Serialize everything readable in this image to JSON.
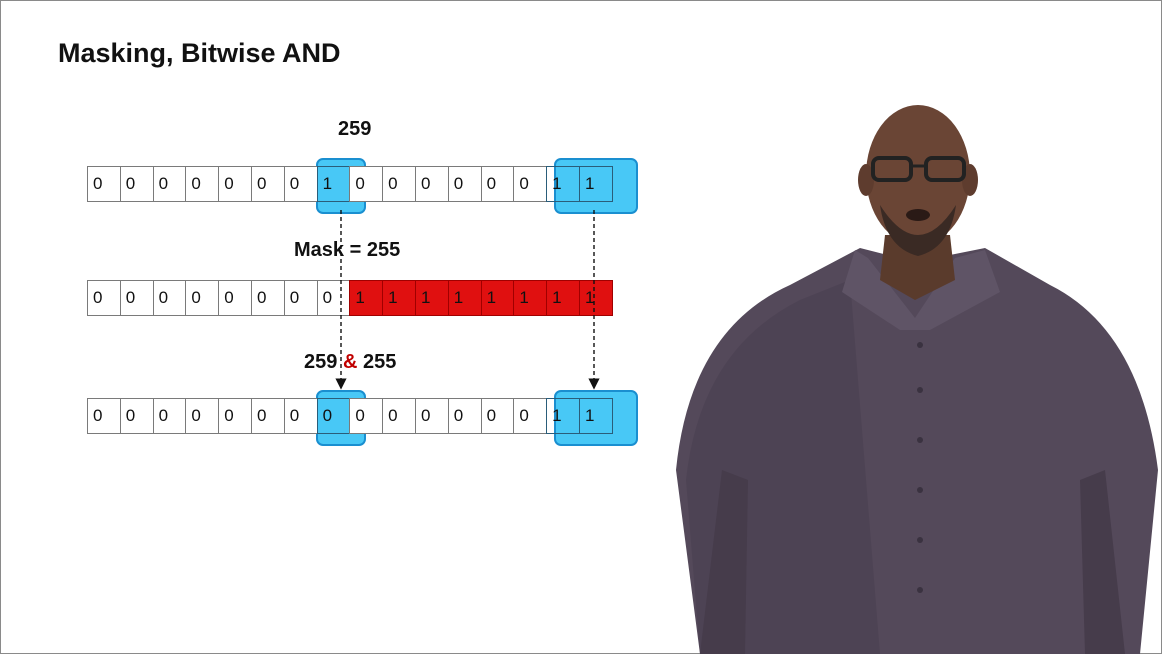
{
  "slide": {
    "title": "Masking, Bitwise AND",
    "labels": {
      "value": "259",
      "mask": "Mask = 255",
      "result_left": "259",
      "result_op": "&",
      "result_right": "255"
    },
    "rows": {
      "value_bits": [
        "0",
        "0",
        "0",
        "0",
        "0",
        "0",
        "0",
        "1",
        "0",
        "0",
        "0",
        "0",
        "0",
        "0",
        "1",
        "1"
      ],
      "mask_bits": [
        "0",
        "0",
        "0",
        "0",
        "0",
        "0",
        "0",
        "0",
        "1",
        "1",
        "1",
        "1",
        "1",
        "1",
        "1",
        "1"
      ],
      "result_bits": [
        "0",
        "0",
        "0",
        "0",
        "0",
        "0",
        "0",
        "0",
        "0",
        "0",
        "0",
        "0",
        "0",
        "0",
        "1",
        "1"
      ]
    }
  },
  "colors": {
    "highlight": "#28bef5",
    "mask_fill": "#e01010",
    "ampersand": "#c00000"
  }
}
